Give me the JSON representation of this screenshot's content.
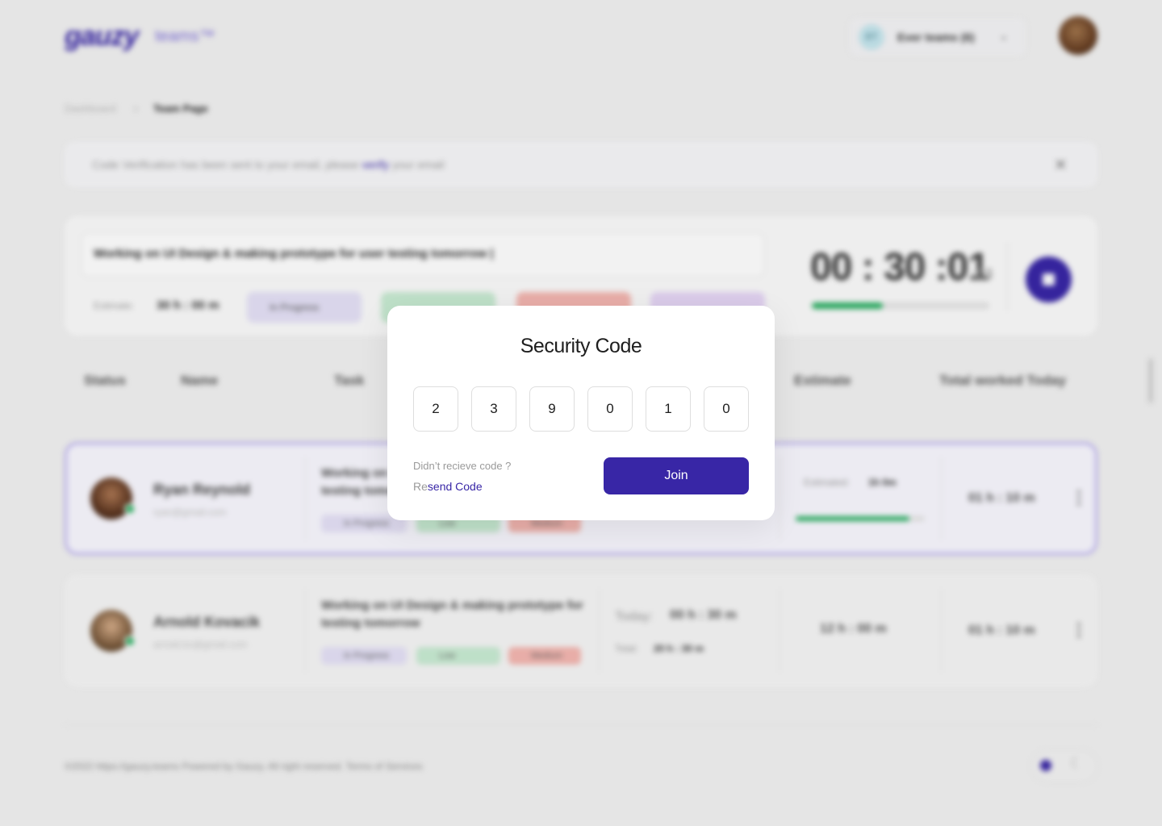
{
  "header": {
    "logo_text": "gauzy",
    "logo_sub": "teams™",
    "team_avatar_initials": "ET",
    "team_name": "Ever teams (6)",
    "team_chevron": "⌄"
  },
  "breadcrumb": {
    "items": [
      "Dashboard",
      "Team Page"
    ],
    "separator": "›"
  },
  "notice": {
    "text": "Code Verification has been sent to your email, please ",
    "link": "verify",
    "suffix": " your email",
    "close": "✕"
  },
  "task_panel": {
    "task_text": "Working on UI Design & making prototype for user testing tomorrow |",
    "estimate_label": "Estimate:",
    "estimate_value": "30 h : 00 m",
    "status_pill": "In Progress",
    "timer": "00 : 30 :01",
    "timer_ms": ":03",
    "progress_pct": 40
  },
  "table": {
    "headers": [
      "Status",
      "Name",
      "Task",
      "Estimate",
      "Total worked Today"
    ],
    "rows": [
      {
        "name": "Ryan Reynold",
        "email": "ryan@gmail.com",
        "task": "Working on UI Design & making prototype for testing tomorrow",
        "tags": [
          "In Progress",
          "Low",
          "Medium"
        ],
        "estimated_label": "Estimated:",
        "estimated_value": "1h 0m",
        "estimate_progress_pct": 88,
        "total": "01 h : 10 m"
      },
      {
        "name": "Arnold Kovacik",
        "email": "arnold.ko@gmail.com",
        "task": "Working on UI Design & making prototype for testing tomorrow",
        "tags": [
          "In Progress",
          "Low",
          "Medium"
        ],
        "today_label": "Today:",
        "today_value": "00 h : 30 m",
        "total_label": "Total:",
        "total_value": "20 h : 30 m",
        "estimate_value": "12 h : 00 m",
        "total": "01 h : 10 m"
      }
    ],
    "kebab": "⋮"
  },
  "footer": {
    "text": "©2022 https://gauzy.teams Powered by Gauzy. All right reserved. Terms of Services"
  },
  "modal": {
    "title": "Security Code",
    "code_digits": [
      "2",
      "3",
      "9",
      "0",
      "1",
      "0"
    ],
    "no_code_text": "Didn’t recieve code ?",
    "resend_prefix": "Re",
    "resend_link": "send Code",
    "join_label": "Join"
  },
  "colors": {
    "accent": "#3826a6",
    "success": "#27ae60",
    "border": "#dedede"
  },
  "icons": {
    "close": "close-icon",
    "chevron": "chevron-down-icon",
    "stop": "stop-icon",
    "moon": "moon-icon",
    "kebab": "kebab-icon"
  }
}
